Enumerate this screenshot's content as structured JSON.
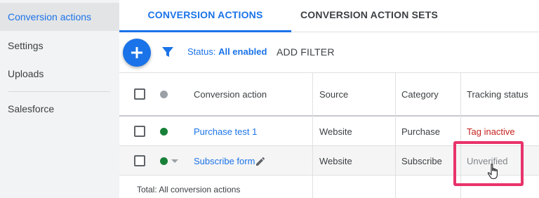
{
  "sidebar": {
    "items": [
      {
        "label": "Conversion actions",
        "active": true
      },
      {
        "label": "Settings",
        "active": false
      },
      {
        "label": "Uploads",
        "active": false
      },
      {
        "label": "Salesforce",
        "active": false
      }
    ]
  },
  "tabs": [
    {
      "label": "CONVERSION ACTIONS",
      "active": true
    },
    {
      "label": "CONVERSION ACTION SETS",
      "active": false
    }
  ],
  "toolbar": {
    "add_icon": "plus-icon",
    "filter_icon": "funnel-icon",
    "status_prefix": "Status: ",
    "status_value": "All enabled",
    "add_filter_label": "ADD FILTER"
  },
  "table": {
    "columns": [
      "Conversion action",
      "Source",
      "Category",
      "Tracking status"
    ],
    "rows": [
      {
        "name": "Purchase test 1",
        "source": "Website",
        "category": "Purchase",
        "tracking_status": "Tag inactive",
        "status_color": "#188038"
      },
      {
        "name": "Subscribe form",
        "source": "Website",
        "category": "Subscribe",
        "tracking_status": "Unverified",
        "status_color": "#188038"
      }
    ],
    "total_label": "Total: All conversion actions"
  },
  "colors": {
    "accent": "#1a73e8",
    "sidebar_bg": "#f1f3f4",
    "tag_inactive": "#c5221f",
    "highlight_box": "#e8336b"
  }
}
